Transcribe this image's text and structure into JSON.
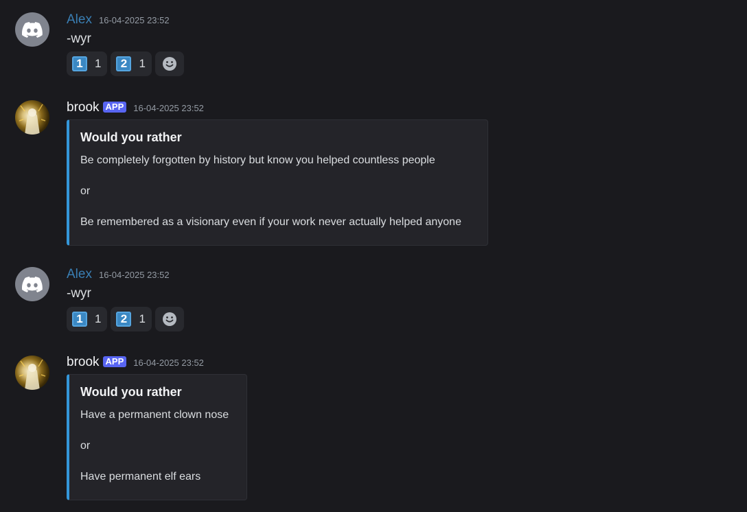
{
  "messages": [
    {
      "author": "Alex",
      "timestamp": "16-04-2025 23:52",
      "content": "-wyr",
      "reactions": [
        {
          "emoji": "1",
          "count": "1"
        },
        {
          "emoji": "2",
          "count": "1"
        }
      ]
    },
    {
      "author": "brook",
      "badge": "APP",
      "timestamp": "16-04-2025 23:52",
      "embed": {
        "title": "Would you rather",
        "option1": "Be completely forgotten by history but know you helped countless people",
        "separator": "or",
        "option2": "Be remembered as a visionary even if your work never actually helped anyone"
      }
    },
    {
      "author": "Alex",
      "timestamp": "16-04-2025 23:52",
      "content": "-wyr",
      "reactions": [
        {
          "emoji": "1",
          "count": "1"
        },
        {
          "emoji": "2",
          "count": "1"
        }
      ]
    },
    {
      "author": "brook",
      "badge": "APP",
      "timestamp": "16-04-2025 23:52",
      "embed": {
        "title": "Would you rather",
        "option1": "Have a permanent clown nose",
        "separator": "or",
        "option2": "Have permanent elf ears"
      }
    }
  ],
  "icons": {
    "discord_avatar": "discord-logo-icon",
    "add_reaction": "smiley-icon"
  },
  "colors": {
    "background": "#1a1a1e",
    "alex_name": "#3a7fb4",
    "app_badge": "#5865f2",
    "embed_accent": "#3497da",
    "keycap": "#3b88c3"
  }
}
